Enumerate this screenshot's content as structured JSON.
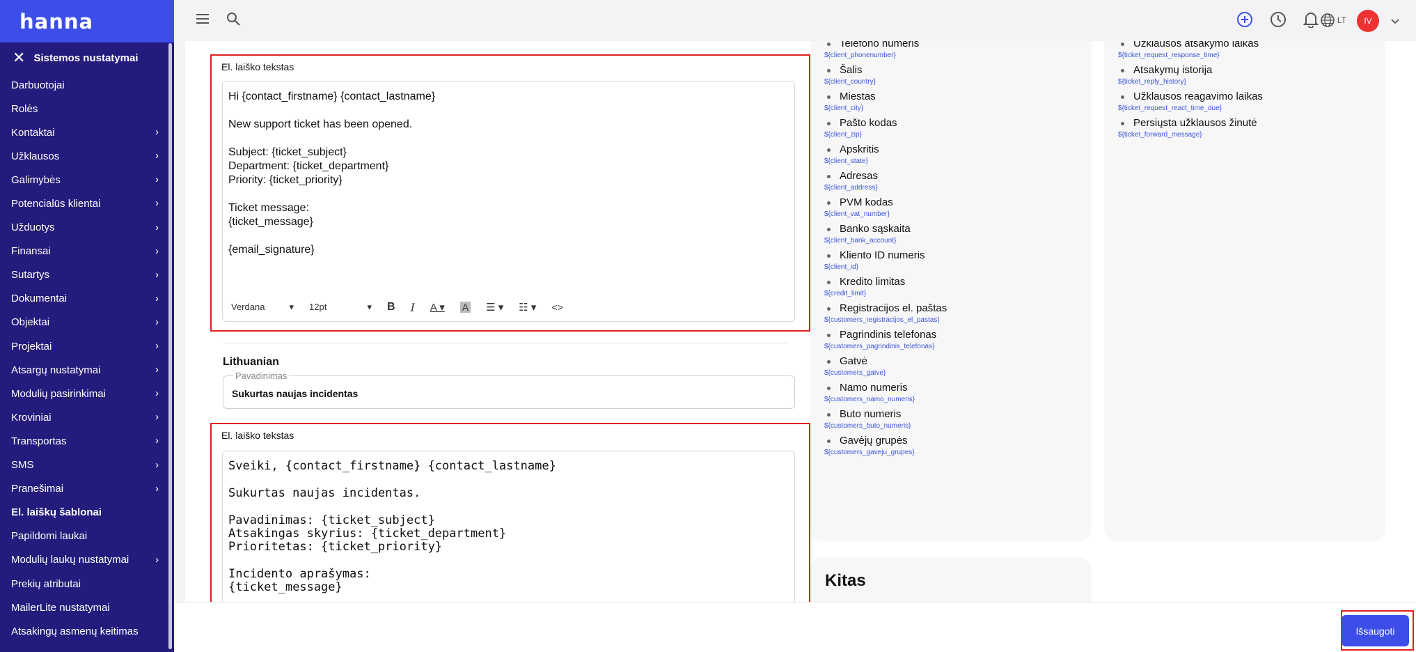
{
  "brand": {
    "logo_text": "hanna"
  },
  "sidebar": {
    "section_title": "Sistemos nustatymai",
    "items": [
      {
        "label": "Darbuotojai",
        "chevron": false
      },
      {
        "label": "Rolės",
        "chevron": false
      },
      {
        "label": "Kontaktai",
        "chevron": true
      },
      {
        "label": "Užklausos",
        "chevron": true
      },
      {
        "label": "Galimybės",
        "chevron": true
      },
      {
        "label": "Potencialūs klientai",
        "chevron": true
      },
      {
        "label": "Užduotys",
        "chevron": true
      },
      {
        "label": "Finansai",
        "chevron": true
      },
      {
        "label": "Sutartys",
        "chevron": true
      },
      {
        "label": "Dokumentai",
        "chevron": true
      },
      {
        "label": "Objektai",
        "chevron": true
      },
      {
        "label": "Projektai",
        "chevron": true
      },
      {
        "label": "Atsargų nustatymai",
        "chevron": true
      },
      {
        "label": "Modulių pasirinkimai",
        "chevron": true
      },
      {
        "label": "Kroviniai",
        "chevron": true
      },
      {
        "label": "Transportas",
        "chevron": true
      },
      {
        "label": "SMS",
        "chevron": true
      },
      {
        "label": "Pranešimai",
        "chevron": true
      },
      {
        "label": "El. laiškų šablonai",
        "chevron": false,
        "active": true
      },
      {
        "label": "Papildomi laukai",
        "chevron": false
      },
      {
        "label": "Modulių laukų nustatymai",
        "chevron": true
      },
      {
        "label": "Prekių atributai",
        "chevron": false
      },
      {
        "label": "MailerLite nustatymai",
        "chevron": false
      },
      {
        "label": "Atsakingų asmenų keitimas",
        "chevron": false
      }
    ]
  },
  "topbar": {
    "lang": "LT",
    "avatar_initials": "IV",
    "accent": "#3d4ee8",
    "avatar_color": "#ee3131"
  },
  "english_editor": {
    "label": "El. laiško tekstas",
    "paragraphs": [
      "Hi {contact_firstname} {contact_lastname}",
      "New support ticket has been opened.",
      "Subject: {ticket_subject}\nDepartment: {ticket_department}\nPriority: {ticket_priority}",
      "Ticket message:\n{ticket_message}",
      "{email_signature}"
    ],
    "font_name": "Verdana",
    "font_size": "12pt"
  },
  "lithuanian": {
    "language": "Lithuanian",
    "name_placeholder": "Pavadinimas",
    "name_value": "Sukurtas naujas incidentas",
    "editor_label": "El. laiško tekstas",
    "paragraphs": [
      "Sveiki, {contact_firstname} {contact_lastname}",
      "Sukurtas naujas incidentas.",
      "Pavadinimas: {ticket_subject}\nAtsakingas skyrius: {ticket_department}\nPrioritetas: {ticket_priority}",
      "Incidento aprašymas:\n{ticket_message}"
    ]
  },
  "client_vars": [
    {
      "name": "Telefono numeris",
      "code": "${client_phonenumber}"
    },
    {
      "name": "Šalis",
      "code": "${client_country}"
    },
    {
      "name": "Miestas",
      "code": "${client_city}"
    },
    {
      "name": "Pašto kodas",
      "code": "${client_zip}"
    },
    {
      "name": "Apskritis",
      "code": "${client_state}"
    },
    {
      "name": "Adresas",
      "code": "${client_address}"
    },
    {
      "name": "PVM kodas",
      "code": "${client_vat_number}"
    },
    {
      "name": "Banko sąskaita",
      "code": "${client_bank_account}"
    },
    {
      "name": "Kliento ID numeris",
      "code": "${client_id}"
    },
    {
      "name": "Kredito limitas",
      "code": "${credit_limit}"
    },
    {
      "name": "Registracijos el. paštas",
      "code": "${customers_registracijos_el_pastas}"
    },
    {
      "name": "Pagrindinis telefonas",
      "code": "${customers_pagrindinis_telefonas}"
    },
    {
      "name": "Gatvė",
      "code": "${customers_gatve}"
    },
    {
      "name": "Namo numeris",
      "code": "${customers_namo_numeris}"
    },
    {
      "name": "Buto numeris",
      "code": "${customers_buto_numeris}"
    },
    {
      "name": "Gavėjų grupės",
      "code": "${customers_gaveju_grupes}"
    }
  ],
  "ticket_vars": [
    {
      "name": "Užklausos atsakymo laikas",
      "code": "${ticket_request_response_time}"
    },
    {
      "name": "Atsakymų istorija",
      "code": "${ticket_reply_history}"
    },
    {
      "name": "Užklausos reagavimo laikas",
      "code": "${ticket_request_react_time_due}"
    },
    {
      "name": "Persiųsta užklausos žinutė",
      "code": "${ticket_forward_message}"
    }
  ],
  "other_section_title": "Kitas",
  "save_label": "Išsaugoti"
}
